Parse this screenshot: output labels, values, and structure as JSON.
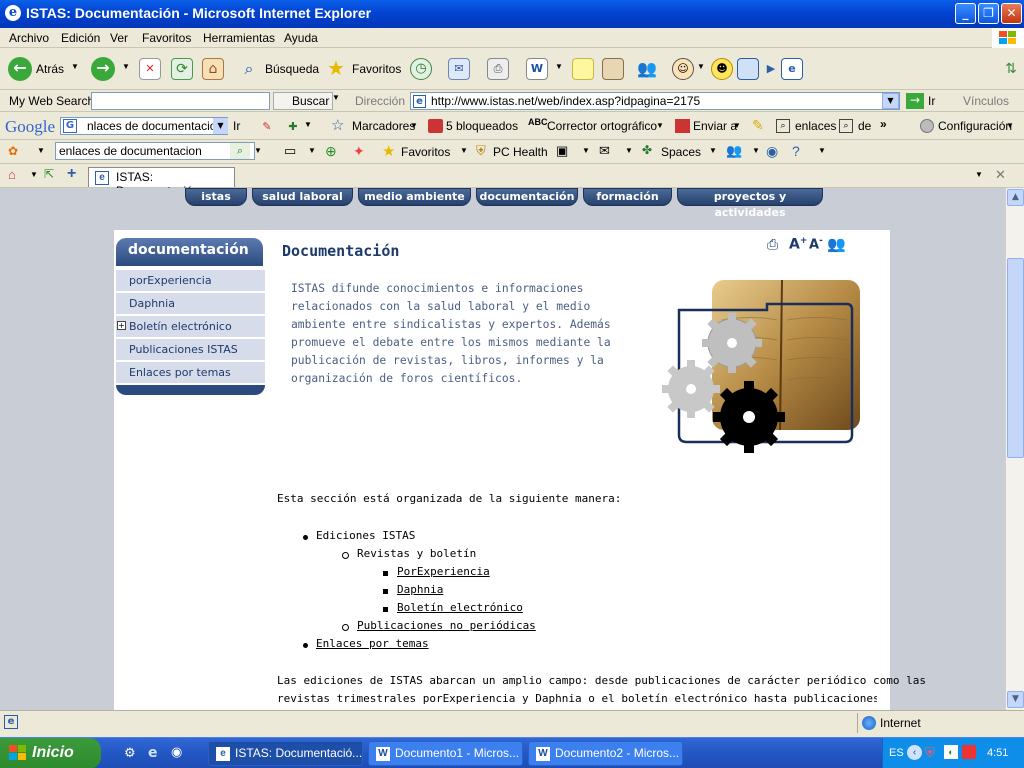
{
  "window": {
    "title": "ISTAS: Documentación - Microsoft Internet Explorer"
  },
  "menu": [
    "Archivo",
    "Edición",
    "Ver",
    "Favoritos",
    "Herramientas",
    "Ayuda"
  ],
  "toolbar": {
    "back": "Atrás",
    "search": "Búsqueda",
    "favorites": "Favoritos"
  },
  "searchbar": {
    "label": "My Web Search",
    "button": "Buscar",
    "address_label": "Dirección",
    "url": "http://www.istas.net/web/index.asp?idpagina=2175",
    "go": "Ir",
    "links": "Vínculos"
  },
  "googlebar": {
    "logo": "Google",
    "query": "nlaces de documentacion",
    "go": "Ir",
    "bookmarks": "Marcadores",
    "blocked": "5 bloqueados",
    "spellcheck": "Corrector ortográfico",
    "send": "Enviar a",
    "links": "enlaces",
    "de": "de",
    "settings": "Configuración"
  },
  "linksbar": {
    "query": "enlaces de documentacion",
    "favorites": "Favoritos",
    "pc_health": "PC Health",
    "spaces": "Spaces"
  },
  "tab": {
    "title": "ISTAS: Documentación"
  },
  "site": {
    "nav": [
      "istas",
      "salud laboral",
      "medio ambiente",
      "documentación",
      "formación",
      "proyectos y actividades"
    ],
    "sidebar": {
      "heading": "documentación",
      "items": [
        "porExperiencia",
        "Daphnia",
        "Boletín electrónico",
        "Publicaciones ISTAS",
        "Enlaces por temas"
      ]
    },
    "page_title": "Documentación",
    "intro": "ISTAS difunde conocimientos e informaciones relacionados con la salud laboral y el medio ambiente entre sindicalistas y expertos. Además promueve el debate entre los mismos mediante la publicación de revistas, libros, informes y la organización de foros científicos.",
    "section_intro": "Esta sección está organizada de la siguiente manera:",
    "tree": {
      "ediciones": "Ediciones ISTAS",
      "revistas": "Revistas y boletín",
      "porexperiencia": "PorExperiencia",
      "daphnia": "Daphnia",
      "boletin": "Boletín electrónico",
      "no_periodicas": "Publicaciones no periódicas",
      "enlaces": "Enlaces por temas"
    },
    "footer_text_1": "Las ediciones de ISTAS abarcan un amplio campo: desde publicaciones de carácter periódico como las",
    "footer_text_2": "revistas trimestrales porExperiencia y Daphnia o el boletín electrónico hasta publicaciones de carácter no"
  },
  "statusbar": {
    "zone": "Internet"
  },
  "taskbar": {
    "start": "Inicio",
    "buttons": [
      "ISTAS: Documentació...",
      "Documento1 - Micros...",
      "Documento2 - Micros..."
    ],
    "lang": "ES",
    "clock": "4:51"
  }
}
